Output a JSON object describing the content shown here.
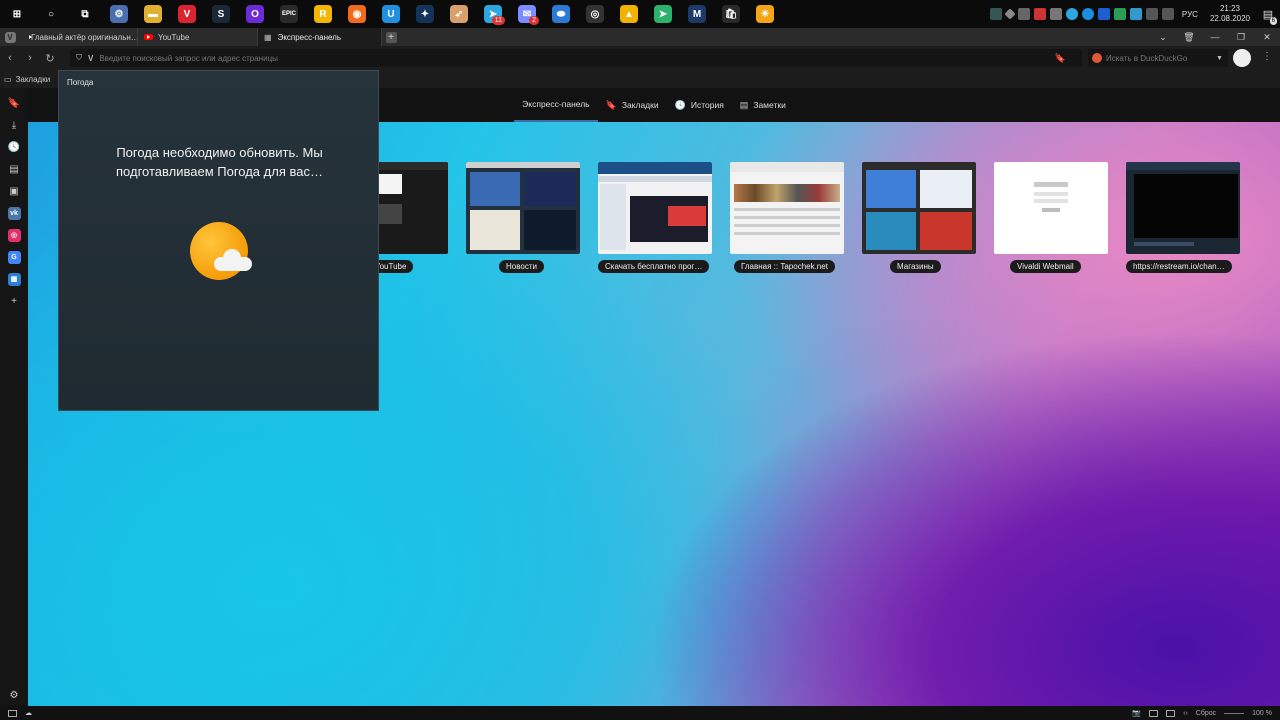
{
  "taskbar": {
    "apps": [
      {
        "name": "windows-start",
        "glyph": "⊞",
        "color": "#0b0b0b"
      },
      {
        "name": "search",
        "glyph": "○",
        "color": "#0b0b0b"
      },
      {
        "name": "task-view",
        "glyph": "⧉",
        "color": "#0b0b0b"
      },
      {
        "name": "settings",
        "glyph": "⚙",
        "color": "#4a6fb0"
      },
      {
        "name": "file-explorer",
        "glyph": "▬",
        "color": "#e0b030"
      },
      {
        "name": "vivaldi",
        "glyph": "V",
        "color": "#d8252f"
      },
      {
        "name": "steam",
        "glyph": "S",
        "color": "#1b2838"
      },
      {
        "name": "o-app",
        "glyph": "O",
        "color": "#6b2bd6"
      },
      {
        "name": "epic-games",
        "glyph": "EPIC",
        "color": "#2a2a2a"
      },
      {
        "name": "rockstar",
        "glyph": "R",
        "color": "#f2b705"
      },
      {
        "name": "origin",
        "glyph": "◉",
        "color": "#f26a1b"
      },
      {
        "name": "uplay",
        "glyph": "U",
        "color": "#1f8fe0"
      },
      {
        "name": "battle-net",
        "glyph": "✦",
        "color": "#14335a"
      },
      {
        "name": "app-feather",
        "glyph": "➶",
        "color": "#d9a06b"
      },
      {
        "name": "telegram",
        "glyph": "➤",
        "color": "#2ea6de",
        "badge": "11"
      },
      {
        "name": "messenger",
        "glyph": "✉",
        "color": "#7a8cff",
        "badge": "2"
      },
      {
        "name": "game-app",
        "glyph": "⬬",
        "color": "#2b7bd6"
      },
      {
        "name": "obs",
        "glyph": "◎",
        "color": "#333"
      },
      {
        "name": "app-triangle",
        "glyph": "▲",
        "color": "#f0b400"
      },
      {
        "name": "app-send",
        "glyph": "➤",
        "color": "#2cb36b"
      },
      {
        "name": "app-m",
        "glyph": "M",
        "color": "#1d3b66"
      },
      {
        "name": "store",
        "glyph": "🛍",
        "color": "#2a2a2a"
      },
      {
        "name": "weather",
        "glyph": "☀",
        "color": "#f4a415"
      }
    ],
    "tray": {
      "lang": "РУС",
      "time": "21:23",
      "date": "22.08.2020",
      "notifications": "6"
    }
  },
  "tabs": [
    {
      "label": "Главный актёр оригинальн…",
      "type": "youtube"
    },
    {
      "label": "YouTube",
      "type": "youtube"
    },
    {
      "label": "Экспресс-панель",
      "type": "speed-dial",
      "active": true
    }
  ],
  "address": {
    "placeholder": "Введите поисковый запрос или адрес страницы",
    "search_placeholder": "Искать в DuckDuckGo"
  },
  "bookmarks_bar": {
    "label": "Закладки"
  },
  "speed_dial_header": {
    "tabs": [
      {
        "label": "Экспресс-панель",
        "icon": "",
        "active": true
      },
      {
        "label": "Закладки",
        "icon": "🔖"
      },
      {
        "label": "История",
        "icon": "🕓"
      },
      {
        "label": "Заметки",
        "icon": "▤"
      }
    ]
  },
  "dials": [
    {
      "label": "YouTube"
    },
    {
      "label": "Новости"
    },
    {
      "label": "Скачать бесплатно прог…"
    },
    {
      "label": "Главная :: Tapochek.net"
    },
    {
      "label": "Магазины"
    },
    {
      "label": "Vivaldi Webmail"
    },
    {
      "label": "https://restream.io/chan…"
    }
  ],
  "weather_panel": {
    "title": "Погода",
    "message_line1": "Погода необходимо обновить. Мы",
    "message_line2": "подготавливаем Погода для вас…"
  },
  "status": {
    "reset": "Сброс",
    "zoom": "100 %"
  }
}
